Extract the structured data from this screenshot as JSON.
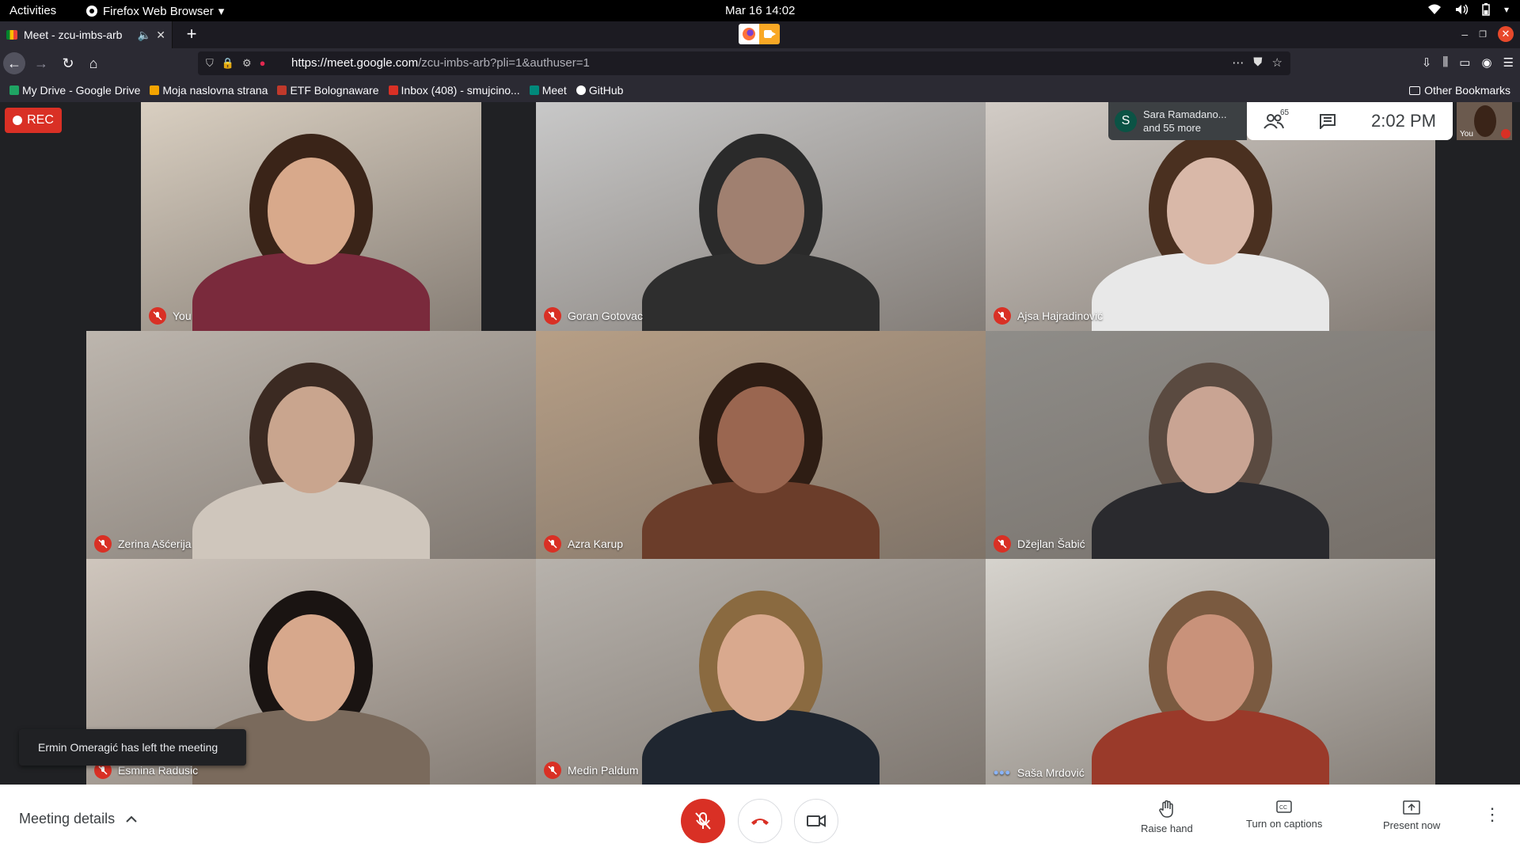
{
  "gnome": {
    "activities": "Activities",
    "app_name": "Firefox Web Browser",
    "clock": "Mar 16  14:02"
  },
  "browser": {
    "tab_title": "Meet - zcu-imbs-arb",
    "url_host": "https://meet.google.com",
    "url_path": "/zcu-imbs-arb?pli=1&authuser=1",
    "bookmarks": [
      {
        "label": "My Drive - Google Drive",
        "color": "#1fa463"
      },
      {
        "label": "Moja naslovna strana",
        "color": "#f4a400"
      },
      {
        "label": "ETF Bolognaware",
        "color": "#c0392b"
      },
      {
        "label": "Inbox (408) - smujcino...",
        "color": "#d93025"
      },
      {
        "label": "Meet",
        "color": "#00897b"
      },
      {
        "label": "GitHub",
        "color": "#ffffff"
      }
    ],
    "other_bookmarks": "Other Bookmarks"
  },
  "meet": {
    "rec_label": "REC",
    "participants": [
      {
        "name": "You",
        "bg": "#d9cfc1",
        "skin": "#d8a98b",
        "hair": "#3a2418",
        "shirt": "#7a2a3c"
      },
      {
        "name": "Goran Gotovac",
        "bg": "#c8c8c8",
        "skin": "#a08070",
        "hair": "#2a2a2a",
        "shirt": "#2e2e2e"
      },
      {
        "name": "Ajsa Hajradinović",
        "bg": "#d2ccc6",
        "skin": "#d9b8a8",
        "hair": "#4a3020",
        "shirt": "#e8e8e8"
      },
      {
        "name": "Zerina Ašćerija",
        "bg": "#bdb6ae",
        "skin": "#c9a58e",
        "hair": "#3b2a22",
        "shirt": "#cfc6bc"
      },
      {
        "name": "Azra Karup",
        "bg": "#b79f86",
        "skin": "#9a6650",
        "hair": "#2e1d14",
        "shirt": "#6b3d2a"
      },
      {
        "name": "Džejlan Šabić",
        "bg": "#8f8d89",
        "skin": "#c9a493",
        "hair": "#5a4a40",
        "shirt": "#2a2a2e"
      },
      {
        "name": "Esmina Radusic",
        "bg": "#cfc6bd",
        "skin": "#d7a88c",
        "hair": "#1a1412",
        "shirt": "#7a6a5c"
      },
      {
        "name": "Medin Paldum",
        "bg": "#b7b2ac",
        "skin": "#d9a98e",
        "hair": "#8a6a40",
        "shirt": "#1f2630"
      },
      {
        "name": "Saša Mrdović",
        "bg": "#d6d3cd",
        "skin": "#c9927a",
        "hair": "#7a5a40",
        "shirt": "#9a3a2a"
      }
    ],
    "people_chip_name": "Sara Ramadano...",
    "people_chip_more": "and 55 more",
    "people_chip_initial": "S",
    "people_count": "65",
    "time": "2:02  PM",
    "self_thumb_label": "You",
    "toast": "Ermin Omeragić has left the meeting",
    "meeting_details": "Meeting details",
    "actions": {
      "raise_hand": "Raise hand",
      "captions": "Turn on captions",
      "present": "Present now"
    }
  },
  "colors": {
    "accent_red": "#d93025",
    "meet_bg": "#202124"
  }
}
